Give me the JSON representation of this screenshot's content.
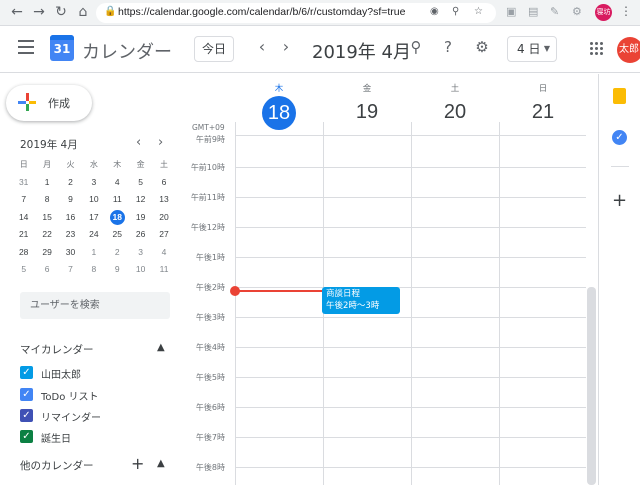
{
  "browser": {
    "url": "https://calendar.google.com/calendar/b/6/r/customday?sf=true",
    "profile_label": "寝坊"
  },
  "header": {
    "app_name": "カレンダー",
    "logo_day": "31",
    "today_button": "今日",
    "period_title": "2019年 4月",
    "view_selector": "4 日",
    "user_avatar": "太郎"
  },
  "sidebar": {
    "create_label": "作成",
    "mini_calendar": {
      "title": "2019年 4月",
      "weekdays": [
        "日",
        "月",
        "火",
        "水",
        "木",
        "金",
        "土"
      ],
      "weeks": [
        [
          "31",
          "1",
          "2",
          "3",
          "4",
          "5",
          "6"
        ],
        [
          "7",
          "8",
          "9",
          "10",
          "11",
          "12",
          "13"
        ],
        [
          "14",
          "15",
          "16",
          "17",
          "18",
          "19",
          "20"
        ],
        [
          "21",
          "22",
          "23",
          "24",
          "25",
          "26",
          "27"
        ],
        [
          "28",
          "29",
          "30",
          "1",
          "2",
          "3",
          "4"
        ],
        [
          "5",
          "6",
          "7",
          "8",
          "9",
          "10",
          "11"
        ]
      ],
      "selected_day": "18"
    },
    "search_people_placeholder": "ユーザーを検索",
    "my_calendars_title": "マイカレンダー",
    "my_calendars": [
      {
        "name": "山田太郎",
        "color": "#039be5"
      },
      {
        "name": "ToDo リスト",
        "color": "#4285f4"
      },
      {
        "name": "リマインダー",
        "color": "#3f51b5"
      },
      {
        "name": "誕生日",
        "color": "#0b8043"
      }
    ],
    "other_calendars_title": "他のカレンダー"
  },
  "main": {
    "timezone": "GMT+09",
    "days": [
      {
        "dow": "木",
        "date": "18",
        "today": true
      },
      {
        "dow": "金",
        "date": "19",
        "today": false
      },
      {
        "dow": "土",
        "date": "20",
        "today": false
      },
      {
        "dow": "日",
        "date": "21",
        "today": false
      }
    ],
    "time_labels": [
      "午前9時",
      "午前10時",
      "午前11時",
      "午後12時",
      "午後1時",
      "午後2時",
      "午後3時",
      "午後4時",
      "午後5時",
      "午後6時",
      "午後7時",
      "午後8時"
    ],
    "event": {
      "title": "商談日程",
      "time": "午後2時～3時",
      "color": "#039be5"
    },
    "now_indicator_color": "#ea4335"
  }
}
